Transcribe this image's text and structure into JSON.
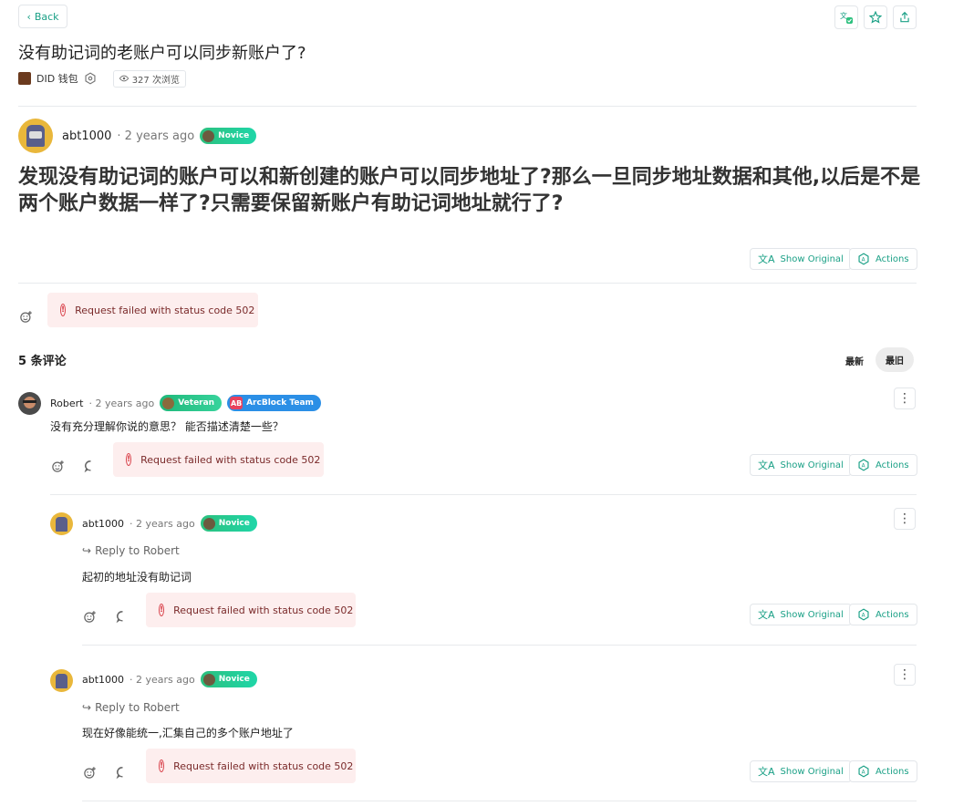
{
  "header": {
    "back_label": "Back",
    "icons": [
      "translate-icon",
      "star-icon",
      "share-icon"
    ]
  },
  "post": {
    "title": "没有助记词的老账户可以同步新账户了?",
    "board": "DID 钱包",
    "views": "327 次浏览",
    "author": "abt1000",
    "time": "· 2 years ago",
    "badge": "Novice",
    "body": "发现没有助记词的账户可以和新创建的账户可以同步地址了?那么一旦同步地址数据和其他,以后是不是两个账户数据一样了?只需要保留新账户有助记词地址就行了?",
    "show_original": "Show Original",
    "actions": "Actions",
    "error": "Request failed with status code 502"
  },
  "comments_header": {
    "count": "5 条评论",
    "sort_latest": "最新",
    "sort_oldest": "最旧"
  },
  "comments": [
    {
      "author": "Robert",
      "time": "· 2 years ago",
      "badges": [
        "Veteran",
        "ArcBlock Team"
      ],
      "text": "没有充分理解你说的意思？ 能否描述清楚一些？",
      "error": "Request failed with status code 502",
      "show_original": "Show Original",
      "actions": "Actions"
    },
    {
      "author": "abt1000",
      "time": "· 2 years ago",
      "badges": [
        "Novice"
      ],
      "reply_to": "Reply to Robert",
      "text": "起初的地址没有助记词",
      "error": "Request failed with status code 502",
      "show_original": "Show Original",
      "actions": "Actions"
    },
    {
      "author": "abt1000",
      "time": "· 2 years ago",
      "badges": [
        "Novice"
      ],
      "reply_to": "Reply to Robert",
      "text": "现在好像能统一,汇集自己的多个账户地址了",
      "error": "Request failed with status code 502",
      "show_original": "Show Original",
      "actions": "Actions"
    }
  ],
  "colors": {
    "accent": "#1aa086",
    "error_bg": "#fdeeee",
    "error_icon": "#d9424b",
    "badge_blue": "#2b8fe6"
  }
}
